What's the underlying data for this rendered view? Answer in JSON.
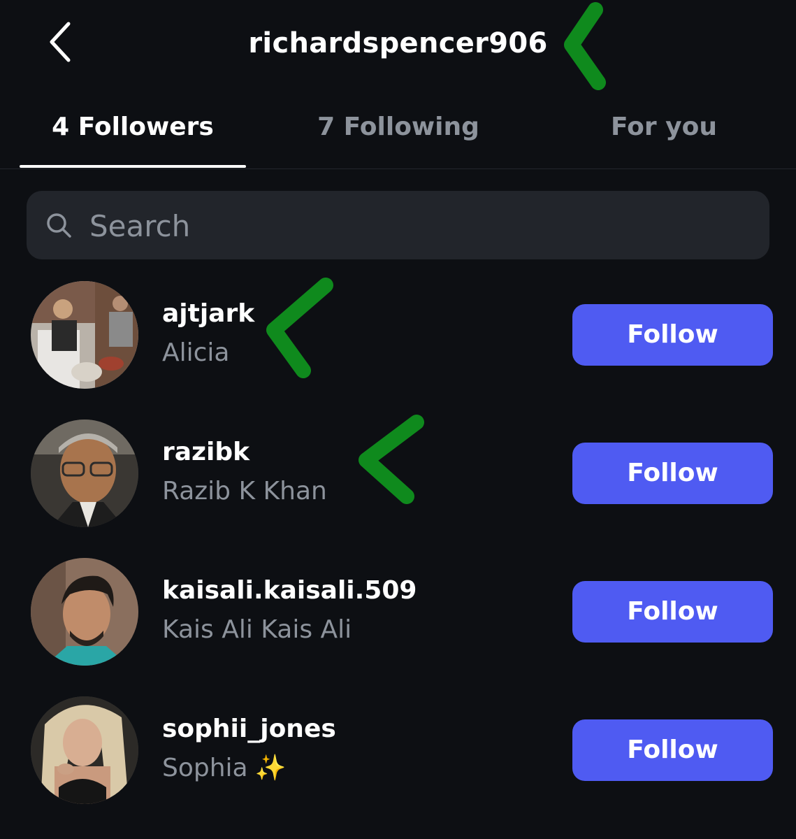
{
  "header": {
    "title": "richardspencer906"
  },
  "tabs": [
    {
      "label": "4 Followers",
      "active": true
    },
    {
      "label": "7 Following",
      "active": false
    },
    {
      "label": "For you",
      "active": false
    }
  ],
  "search": {
    "placeholder": "Search",
    "value": ""
  },
  "followers": [
    {
      "username": "ajtjark",
      "name": "Alicia",
      "button": "Follow"
    },
    {
      "username": "razibk",
      "name": "Razib K Khan",
      "button": "Follow"
    },
    {
      "username": "kaisali.kaisali.509",
      "name": "Kais Ali Kais Ali",
      "button": "Follow"
    },
    {
      "username": "sophii_jones",
      "name": "Sophia",
      "name_emoji": "✨",
      "button": "Follow"
    }
  ],
  "colors": {
    "background": "#0d0f13",
    "search_bg": "#22252b",
    "secondary_text": "#8d939c",
    "follow_button": "#4f5bf2",
    "annotation": "#0f8a1d"
  },
  "icons": {
    "back": "chevron-left-icon",
    "search": "search-icon",
    "annotation": "green-arrow-mark-icon"
  }
}
